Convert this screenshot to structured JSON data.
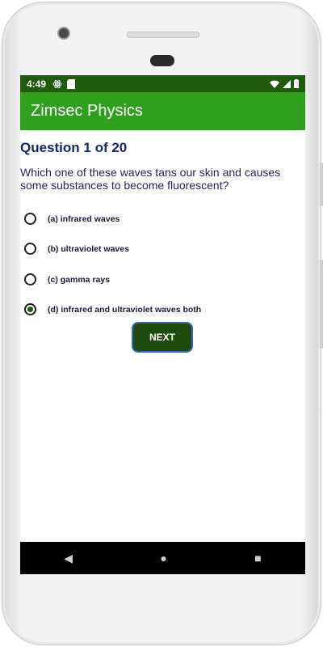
{
  "status": {
    "time": "4:49",
    "left_icons": [
      "atom-icon",
      "sd-card-icon"
    ],
    "right_icons": [
      "wifi-icon",
      "signal-icon",
      "battery-icon"
    ]
  },
  "app": {
    "title": "Zimsec Physics",
    "colors": {
      "status_bar": "#1f5a0d",
      "app_bar": "#2ea01e",
      "button": "#1f4a0d",
      "question_color": "#14276b"
    }
  },
  "quiz": {
    "header": "Question 1 of 20",
    "question": "Which one of these waves tans our skin and causes some substances to become fluorescent?",
    "options": [
      {
        "label": "(a) infrared waves",
        "selected": false
      },
      {
        "label": "(b) ultraviolet waves",
        "selected": false
      },
      {
        "label": "(c) gamma rays",
        "selected": false
      },
      {
        "label": "(d) infrared and ultraviolet waves both",
        "selected": true
      }
    ],
    "next_label": "NEXT"
  },
  "navigation": {
    "back_icon": "◀",
    "home_icon": "●",
    "recents_icon": "■"
  }
}
